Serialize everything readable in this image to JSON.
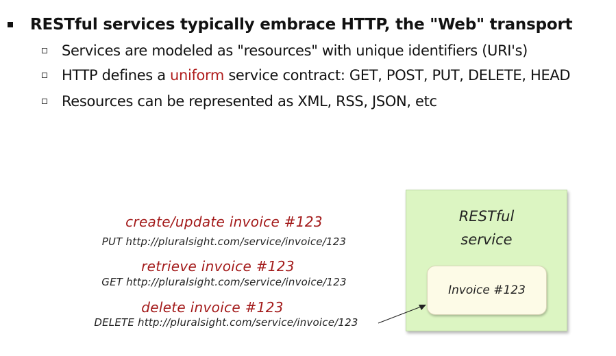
{
  "bullets": {
    "main": "RESTful services typically embrace HTTP, the \"Web\" transport",
    "sub1": "Services are modeled as \"resources\" with unique identifiers (URI's)",
    "sub2_before": "HTTP defines a ",
    "sub2_accent": "uniform",
    "sub2_after": " service contract: GET, POST, PUT, DELETE, HEAD",
    "sub3": "Resources can be represented as XML, RSS, JSON, etc"
  },
  "operations": [
    {
      "label": "create/update invoice #123",
      "request": "PUT http://pluralsight.com/service/invoice/123"
    },
    {
      "label": "retrieve invoice #123",
      "request": "GET  http://pluralsight.com/service/invoice/123"
    },
    {
      "label": "delete invoice #123",
      "request": "DELETE  http://pluralsight.com/service/invoice/123"
    }
  ],
  "service": {
    "title_line1": "RESTful",
    "title_line2": "service",
    "resource": "Invoice #123"
  },
  "colors": {
    "accent": "#b01e1e",
    "service_fill": "#dcf5c2",
    "resource_fill": "#fdfbe7"
  }
}
